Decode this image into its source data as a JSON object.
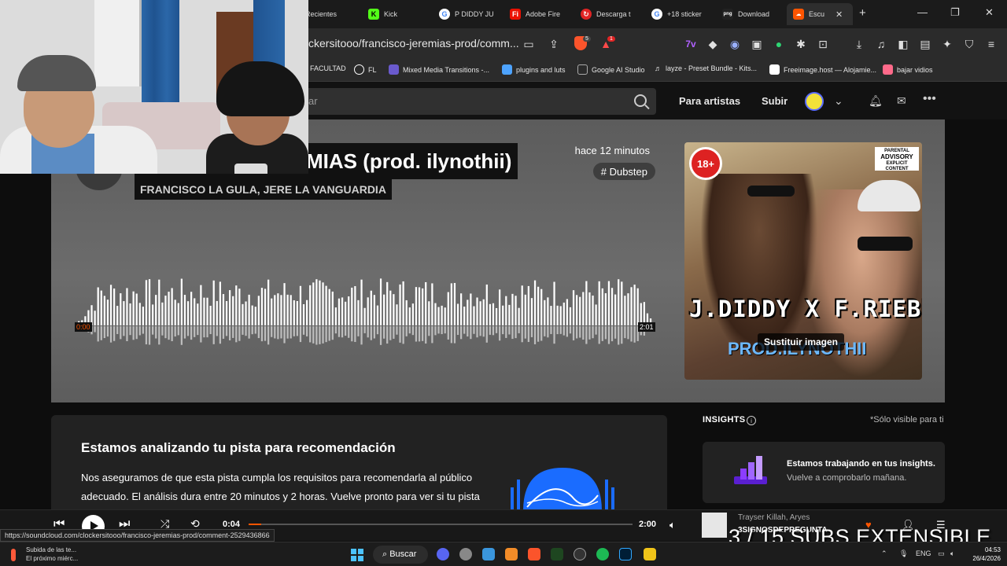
{
  "tabs": [
    {
      "label": "Recientes",
      "icon": "history-icon",
      "color": "#333333"
    },
    {
      "label": "Kick",
      "icon": "kick-icon",
      "color": "#53fc18"
    },
    {
      "label": "P DIDDY JU",
      "icon": "google-icon",
      "color": "#ffffff"
    },
    {
      "label": "Adobe Fire",
      "icon": "adobe-icon",
      "color": "#eb1000"
    },
    {
      "label": "Descarga t",
      "icon": "download-site-icon",
      "color": "#e02424"
    },
    {
      "label": "+18 sticker",
      "icon": "google-icon",
      "color": "#ffffff"
    },
    {
      "label": "Download",
      "icon": "png-icon",
      "color": "#222222"
    },
    {
      "label": "Escu",
      "icon": "soundcloud-icon",
      "color": "#ff5500"
    }
  ],
  "address": {
    "url": "ckersitooo/francisco-jeremias-prod/comm...",
    "brave_shield_count": "5",
    "rewards_count": "1"
  },
  "bookmarks": [
    {
      "label": "FACULTAD",
      "color": "#f0c419"
    },
    {
      "label": "FL",
      "color": "#ffffff"
    },
    {
      "label": "Mixed Media Transitions -...",
      "color": "#a67cff"
    },
    {
      "label": "plugins and luts",
      "color": "#4da3ff"
    },
    {
      "label": "Google AI Studio",
      "color": "#aaaaaa"
    },
    {
      "label": "layze - Preset Bundle - Kits...",
      "color": "#cccccc"
    },
    {
      "label": "Freeimage.host — Alojamie...",
      "color": "#ffffff"
    },
    {
      "label": "bajar vidios",
      "color": "#ff6a8a"
    }
  ],
  "header": {
    "search_placeholder": "ar",
    "for_artists": "Para artistas",
    "upload": "Subir"
  },
  "track": {
    "title": "MIAS (prod. ilynothii)",
    "artists": "FRANCISCO LA GULA, JERE LA VANGUARDIA",
    "time_ago": "hace 12 minutos",
    "genre": "# Dubstep",
    "wave_start": "0:00",
    "wave_end": "2:01",
    "replace_image": "Sustituir imagen",
    "cover_rating": "18+",
    "cover_advisory_top": "PARENTAL",
    "cover_advisory_main": "ADVISORY",
    "cover_advisory_bottom": "EXPLICIT CONTENT",
    "cover_text": "J.DIDDY X F.RIEBER",
    "cover_sub": "PROD.ILYNOTHII"
  },
  "recommendation": {
    "title": "Estamos analizando tu pista para recomendación",
    "text": "Nos aseguramos de que esta pista cumpla los requisitos para recomendarla al público adecuado. El análisis dura entre 20 minutos y 2 horas. Vuelve pronto para ver si tu pista"
  },
  "insights": {
    "heading": "INSIGHTS",
    "only_visible": "*Sólo visible para ti",
    "card_title": "Estamos trabajando en tus insights.",
    "card_sub": "Vuelve a comprobarlo mañana."
  },
  "player": {
    "current": "0:04",
    "duration": "2:00",
    "progress": 0.033,
    "np_artist": "Trayser Killah, Aryes",
    "np_title": "3SIGNOSDEPREGUNTA"
  },
  "overlay": "3 / 15 SUBS EXTENSIBLE",
  "status_url": "https://soundcloud.com/clockersitooo/francisco-jeremias-prod/comment-2529436866",
  "taskbar": {
    "note_title": "Subida de las te...",
    "note_sub": "El próximo miérc...",
    "search": "Buscar",
    "lang": "ENG",
    "time": "04:53",
    "date": "26/4/2026"
  },
  "colors": {
    "accent": "#ff5500",
    "rec_graphic": "#1a6cff",
    "insight_icon": "#8b3dff"
  }
}
